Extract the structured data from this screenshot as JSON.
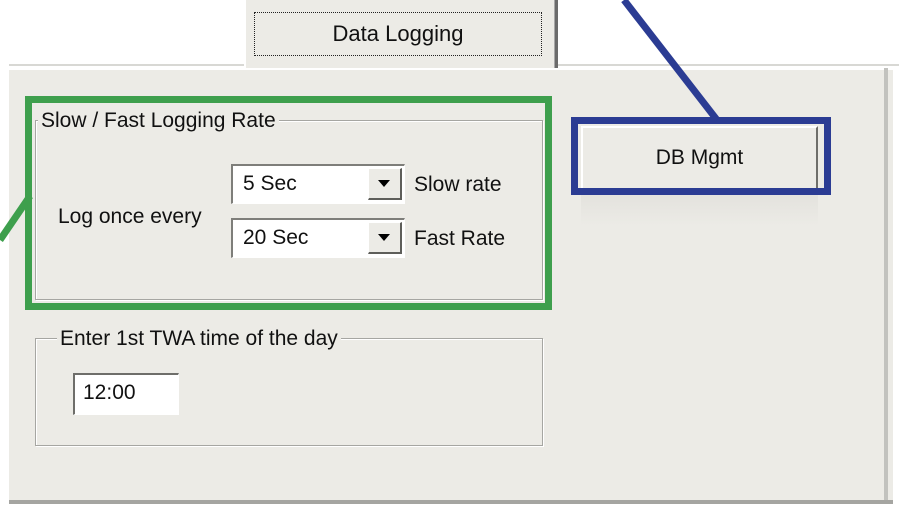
{
  "tab": {
    "label": "Data Logging"
  },
  "logging_rate": {
    "group_title": "Slow / Fast Logging Rate",
    "log_label": "Log once every",
    "slow": {
      "value": "5 Sec",
      "label": "Slow rate"
    },
    "fast": {
      "value": "20 Sec",
      "label": "Fast Rate"
    }
  },
  "twa": {
    "group_title": "Enter 1st TWA time of the day",
    "time_value": "12:00"
  },
  "db_button": {
    "label": "DB Mgmt"
  },
  "annotations": {
    "green_color": "#3e9f4d",
    "blue_color": "#2b3c93"
  }
}
